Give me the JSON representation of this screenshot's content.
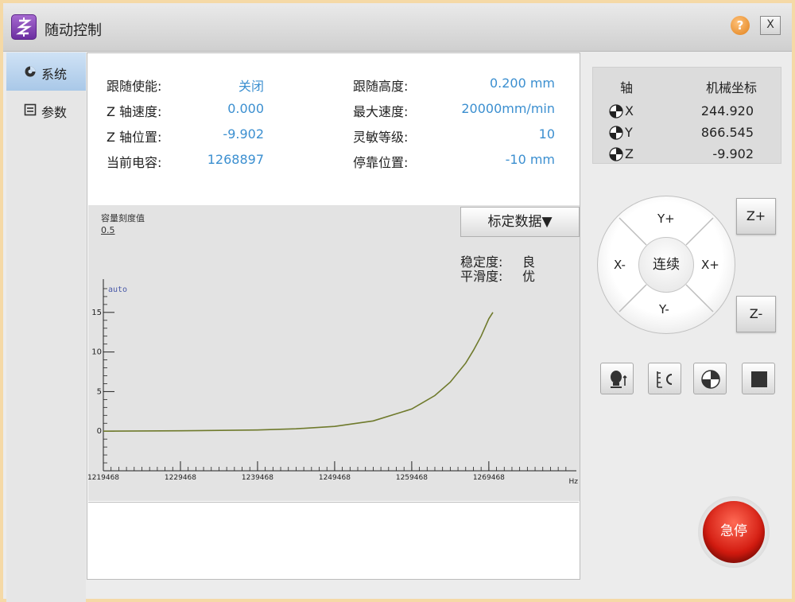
{
  "window": {
    "title": "随动控制",
    "help_glyph": "?",
    "close_glyph": "X"
  },
  "nav": {
    "items": [
      {
        "label": "系统",
        "icon": "gear-icon"
      },
      {
        "label": "参数",
        "icon": "list-icon"
      }
    ]
  },
  "params": {
    "follow_enable": {
      "label": "跟随使能:",
      "value": "关闭"
    },
    "z_speed": {
      "label": "Z 轴速度:",
      "value": "0.000"
    },
    "z_position": {
      "label": "Z 轴位置:",
      "value": "-9.902"
    },
    "capacitance": {
      "label": "当前电容:",
      "value": "1268897"
    },
    "follow_height": {
      "label": "跟随高度:",
      "value": "0.200 mm"
    },
    "max_speed": {
      "label": "最大速度:",
      "value": "20000mm/min"
    },
    "sensitivity": {
      "label": "灵敏等级:",
      "value": "10"
    },
    "stop_position": {
      "label": "停靠位置:",
      "value": "-10 mm"
    }
  },
  "chart_panel": {
    "calib_button": "标定数据▼",
    "header_label": "容量刻度值",
    "header_value": "0.5",
    "auto_label": "auto",
    "stability_label": "稳定度:",
    "stability_value": "良",
    "smoothness_label": "平滑度:",
    "smoothness_value": "优",
    "x_unit": "Hz"
  },
  "chart_data": {
    "type": "line",
    "x_ticks": [
      1219468,
      1229468,
      1239468,
      1249468,
      1259468,
      1269468
    ],
    "x_tick_labels": [
      "1219468",
      "1229468",
      "1239468",
      "1249468",
      "1259468",
      "1269468"
    ],
    "y_ticks": [
      0,
      5,
      10,
      15
    ],
    "y_tick_labels": [
      "0",
      "5",
      "10",
      "15"
    ],
    "xlim": [
      1219468,
      1280000
    ],
    "ylim": [
      -5,
      19
    ],
    "series": [
      {
        "color": "#6f7a2c",
        "points": [
          [
            1219468,
            0.0
          ],
          [
            1229468,
            0.05
          ],
          [
            1239468,
            0.15
          ],
          [
            1244468,
            0.3
          ],
          [
            1249468,
            0.6
          ],
          [
            1254468,
            1.3
          ],
          [
            1259468,
            2.8
          ],
          [
            1262468,
            4.5
          ],
          [
            1264468,
            6.2
          ],
          [
            1266468,
            8.6
          ],
          [
            1267468,
            10.2
          ],
          [
            1268468,
            12.0
          ],
          [
            1269468,
            14.2
          ],
          [
            1270000,
            15.0
          ]
        ]
      }
    ]
  },
  "coords": {
    "header_axis": "轴",
    "header_machine": "机械坐标",
    "rows": [
      {
        "axis": "X",
        "value": "244.920"
      },
      {
        "axis": "Y",
        "value": "866.545"
      },
      {
        "axis": "Z",
        "value": "-9.902"
      }
    ]
  },
  "jog": {
    "y_plus": "Y+",
    "y_minus": "Y-",
    "x_plus": "X+",
    "x_minus": "X-",
    "center": "连续",
    "z_plus": "Z+",
    "z_minus": "Z-"
  },
  "tools": [
    {
      "icon": "touch-probe-icon"
    },
    {
      "icon": "calibrate-icon"
    },
    {
      "icon": "home-origin-icon"
    },
    {
      "icon": "stop-icon"
    }
  ],
  "estop": {
    "label": "急停"
  },
  "colors": {
    "value_blue": "#3b8fd0",
    "nav_active": "#a9c8e8",
    "estop_red": "#d21a0f"
  }
}
